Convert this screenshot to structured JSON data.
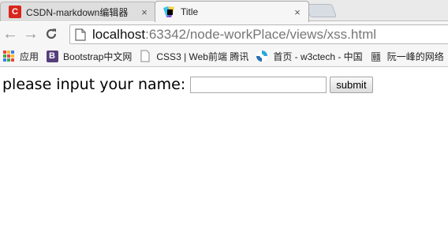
{
  "browser": {
    "tabs": [
      {
        "title": "CSDN-markdown编辑器",
        "icon": "csdn-logo-icon",
        "favicon_text": "C",
        "active": false,
        "color": "#d9251c"
      },
      {
        "title": "Title",
        "icon": "webstorm-logo-icon",
        "active": true
      }
    ],
    "close_glyph": "×",
    "nav": {
      "back": "←",
      "forward": "→",
      "reload": "C"
    },
    "address_bar": {
      "host": "localhost",
      "rest": ":63342/node-workPlace/views/xss.html"
    },
    "bookmarks": [
      {
        "label": "应用",
        "icon": "apps-grid-icon"
      },
      {
        "label": "Bootstrap中文网",
        "icon": "bootstrap-logo-icon",
        "badge": "B",
        "color": "#563d7c"
      },
      {
        "label": "CSS3 | Web前端 腾讯",
        "icon": "page-blank-icon"
      },
      {
        "label": "首页 - w3ctech - 中国",
        "icon": "w3ctech-logo-icon"
      },
      {
        "label": "阮一峰的网络",
        "icon": "ruanyifeng-logo-icon",
        "badge": "㔶"
      }
    ]
  },
  "page": {
    "prompt": "please input your name:",
    "name_input_value": "",
    "submit_label": "submit"
  }
}
